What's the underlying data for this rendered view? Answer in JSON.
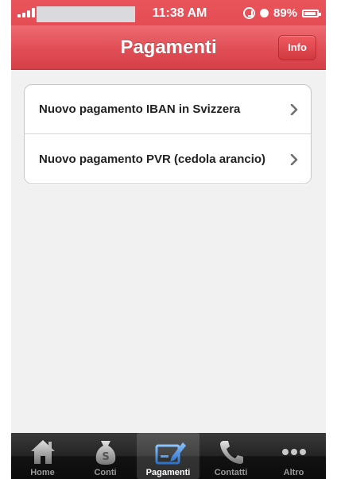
{
  "status_bar": {
    "time": "11:38 AM",
    "battery_percent": "89%",
    "signal_bars": 4
  },
  "nav": {
    "title": "Pagamenti",
    "info_label": "Info"
  },
  "menu": {
    "items": [
      {
        "label": "Nuovo pagamento IBAN in Svizzera",
        "icon": "chevron-right-icon"
      },
      {
        "label": "Nuovo pagamento PVR (cedola arancio)",
        "icon": "chevron-right-icon"
      }
    ]
  },
  "tabbar": {
    "active": "Pagamenti",
    "tabs": [
      {
        "label": "Home",
        "icon": "house-icon"
      },
      {
        "label": "Conti",
        "icon": "money-bag-icon"
      },
      {
        "label": "Pagamenti",
        "icon": "payment-pen-icon"
      },
      {
        "label": "Contatti",
        "icon": "phone-icon"
      },
      {
        "label": "Altro",
        "icon": "more-dots-icon"
      }
    ]
  },
  "colors": {
    "brand_red": "#e14d55",
    "tabbar_dark": "#121212",
    "active_tab_icon": "#4a90d9"
  }
}
